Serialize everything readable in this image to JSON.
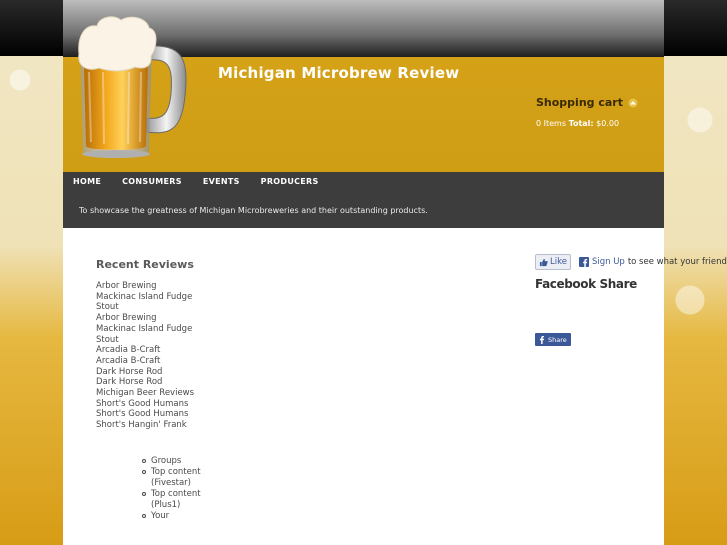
{
  "site": {
    "title": "Michigan Microbrew Review",
    "slogan": "To showcase the greatness of Michigan Microbreweries and their outstanding products."
  },
  "cart": {
    "title": "Shopping cart",
    "items": "0 Items",
    "total_label": "Total:",
    "total_value": "$0.00"
  },
  "menu": [
    "HOME",
    "CONSUMERS",
    "EVENTS",
    "PRODUCERS"
  ],
  "recent_reviews": {
    "title": "Recent Reviews",
    "items": [
      "Arbor Brewing",
      "Mackinac Island Fudge Stout",
      "Arbor Brewing",
      "Mackinac Island Fudge Stout",
      "Arcadia B-Craft",
      "Arcadia B-Craft",
      "Dark Horse Rod",
      "Dark Horse Rod",
      "Michigan Beer Reviews",
      "Short's Good Humans",
      "Short's Good Humans",
      "Short's Hangin' Frank"
    ]
  },
  "navigation": [
    "Groups",
    "Top content (Fivestar)",
    "Top content (Plus1)",
    "Your"
  ],
  "facebook": {
    "like_label": "Like",
    "signup_label": "Sign Up",
    "signup_rest": "to see what your friends like.",
    "share_heading": "Facebook Share",
    "share_button_label": "Share"
  },
  "colors": {
    "header_gold": "#cf9e15",
    "nav_dark": "#3d3d3d",
    "facebook_blue": "#3b5998"
  },
  "icons": [
    "beer-mug-logo",
    "caret-up-icon",
    "thumbs-up-icon",
    "facebook-icon"
  ]
}
